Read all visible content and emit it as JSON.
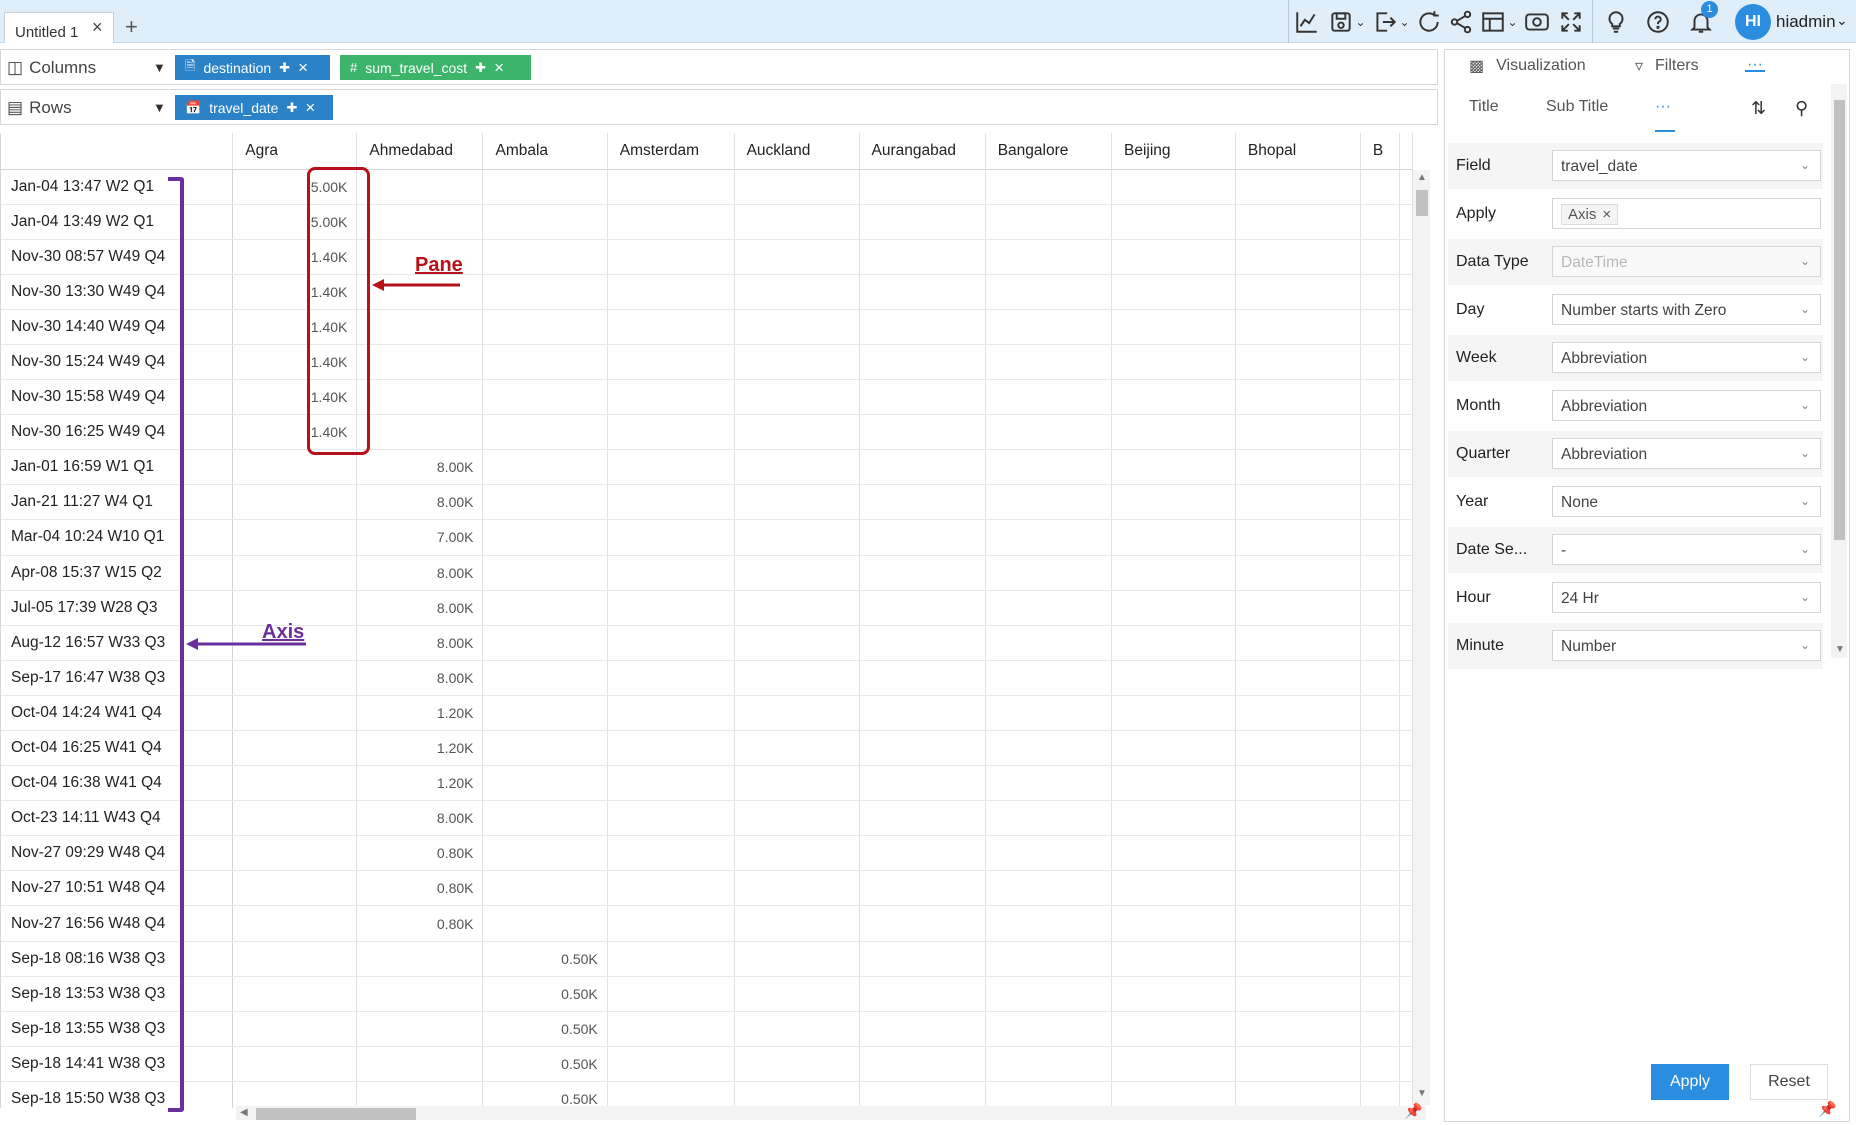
{
  "window": {
    "tab_title": "Untitled 1",
    "tab_close": "×",
    "add_tab": "+",
    "notification_count": "1",
    "user_initials": "HI",
    "username": "hiadmin"
  },
  "toolbar": {
    "icons": [
      "chart-icon",
      "save-icon",
      "export-icon",
      "refresh-icon",
      "share-icon",
      "layout-icon",
      "preview-icon",
      "fullscreen-icon",
      "bulb-icon",
      "help-icon",
      "bell-icon"
    ]
  },
  "shelves": {
    "columns_label": "Columns",
    "rows_label": "Rows",
    "columns_pills": [
      {
        "label": "destination",
        "type": "dimension"
      },
      {
        "label": "sum_travel_cost",
        "type": "measure"
      }
    ],
    "rows_pills": [
      {
        "label": "travel_date",
        "type": "date"
      }
    ]
  },
  "grid": {
    "columns": [
      "Agra",
      "Ahmedabad",
      "Ambala",
      "Amsterdam",
      "Auckland",
      "Aurangabad",
      "Bangalore",
      "Beijing",
      "Bhopal",
      "B"
    ],
    "rows": [
      {
        "label": "Jan-04 13:47 W2 Q1",
        "values": [
          "5.00K",
          "",
          ""
        ]
      },
      {
        "label": "Jan-04 13:49 W2 Q1",
        "values": [
          "5.00K",
          "",
          ""
        ]
      },
      {
        "label": "Nov-30 08:57 W49 Q4",
        "values": [
          "1.40K",
          "",
          ""
        ]
      },
      {
        "label": "Nov-30 13:30 W49 Q4",
        "values": [
          "1.40K",
          "",
          ""
        ]
      },
      {
        "label": "Nov-30 14:40 W49 Q4",
        "values": [
          "1.40K",
          "",
          ""
        ]
      },
      {
        "label": "Nov-30 15:24 W49 Q4",
        "values": [
          "1.40K",
          "",
          ""
        ]
      },
      {
        "label": "Nov-30 15:58 W49 Q4",
        "values": [
          "1.40K",
          "",
          ""
        ]
      },
      {
        "label": "Nov-30 16:25 W49 Q4",
        "values": [
          "1.40K",
          "",
          ""
        ]
      },
      {
        "label": "Jan-01 16:59 W1 Q1",
        "values": [
          "",
          "8.00K",
          ""
        ]
      },
      {
        "label": "Jan-21 11:27 W4 Q1",
        "values": [
          "",
          "8.00K",
          ""
        ]
      },
      {
        "label": "Mar-04 10:24 W10 Q1",
        "values": [
          "",
          "7.00K",
          ""
        ]
      },
      {
        "label": "Apr-08 15:37 W15 Q2",
        "values": [
          "",
          "8.00K",
          ""
        ]
      },
      {
        "label": "Jul-05 17:39 W28 Q3",
        "values": [
          "",
          "8.00K",
          ""
        ]
      },
      {
        "label": "Aug-12 16:57 W33 Q3",
        "values": [
          "",
          "8.00K",
          ""
        ]
      },
      {
        "label": "Sep-17 16:47 W38 Q3",
        "values": [
          "",
          "8.00K",
          ""
        ]
      },
      {
        "label": "Oct-04 14:24 W41 Q4",
        "values": [
          "",
          "1.20K",
          ""
        ]
      },
      {
        "label": "Oct-04 16:25 W41 Q4",
        "values": [
          "",
          "1.20K",
          ""
        ]
      },
      {
        "label": "Oct-04 16:38 W41 Q4",
        "values": [
          "",
          "1.20K",
          ""
        ]
      },
      {
        "label": "Oct-23 14:11 W43 Q4",
        "values": [
          "",
          "8.00K",
          ""
        ]
      },
      {
        "label": "Nov-27 09:29 W48 Q4",
        "values": [
          "",
          "0.80K",
          ""
        ]
      },
      {
        "label": "Nov-27 10:51 W48 Q4",
        "values": [
          "",
          "0.80K",
          ""
        ]
      },
      {
        "label": "Nov-27 16:56 W48 Q4",
        "values": [
          "",
          "0.80K",
          ""
        ]
      },
      {
        "label": "Sep-18 08:16 W38 Q3",
        "values": [
          "",
          "",
          "0.50K"
        ]
      },
      {
        "label": "Sep-18 13:53 W38 Q3",
        "values": [
          "",
          "",
          "0.50K"
        ]
      },
      {
        "label": "Sep-18 13:55 W38 Q3",
        "values": [
          "",
          "",
          "0.50K"
        ]
      },
      {
        "label": "Sep-18 14:41 W38 Q3",
        "values": [
          "",
          "",
          "0.50K"
        ]
      },
      {
        "label": "Sep-18 15:50 W38 Q3",
        "values": [
          "",
          "",
          "0.50K"
        ]
      }
    ]
  },
  "annotations": {
    "pane": "Pane",
    "axis": "Axis",
    "pane_color": "#b5121b",
    "axis_color": "#6a2f9c"
  },
  "panel": {
    "tabs": [
      "Visualization",
      "Filters",
      "···"
    ],
    "subtabs": [
      "Title",
      "Sub Title",
      "···"
    ],
    "properties": [
      {
        "label": "Field",
        "value": "travel_date",
        "kind": "select"
      },
      {
        "label": "Apply",
        "value": "Axis",
        "kind": "chip"
      },
      {
        "label": "Data Type",
        "value": "DateTime",
        "kind": "select-disabled"
      },
      {
        "label": "Day",
        "value": "Number starts with Zero",
        "kind": "select"
      },
      {
        "label": "Week",
        "value": "Abbreviation",
        "kind": "select"
      },
      {
        "label": "Month",
        "value": "Abbreviation",
        "kind": "select"
      },
      {
        "label": "Quarter",
        "value": "Abbreviation",
        "kind": "select"
      },
      {
        "label": "Year",
        "value": "None",
        "kind": "select"
      },
      {
        "label": "Date Se...",
        "value": "-",
        "kind": "select"
      },
      {
        "label": "Hour",
        "value": "24 Hr",
        "kind": "select"
      },
      {
        "label": "Minute",
        "value": "Number",
        "kind": "select"
      }
    ],
    "apply_button": "Apply",
    "reset_button": "Reset"
  },
  "colors": {
    "accent": "#2b8de0",
    "pill_blue": "#2b82c6",
    "pill_green": "#3cb56b",
    "topbar": "#dfeef9"
  }
}
